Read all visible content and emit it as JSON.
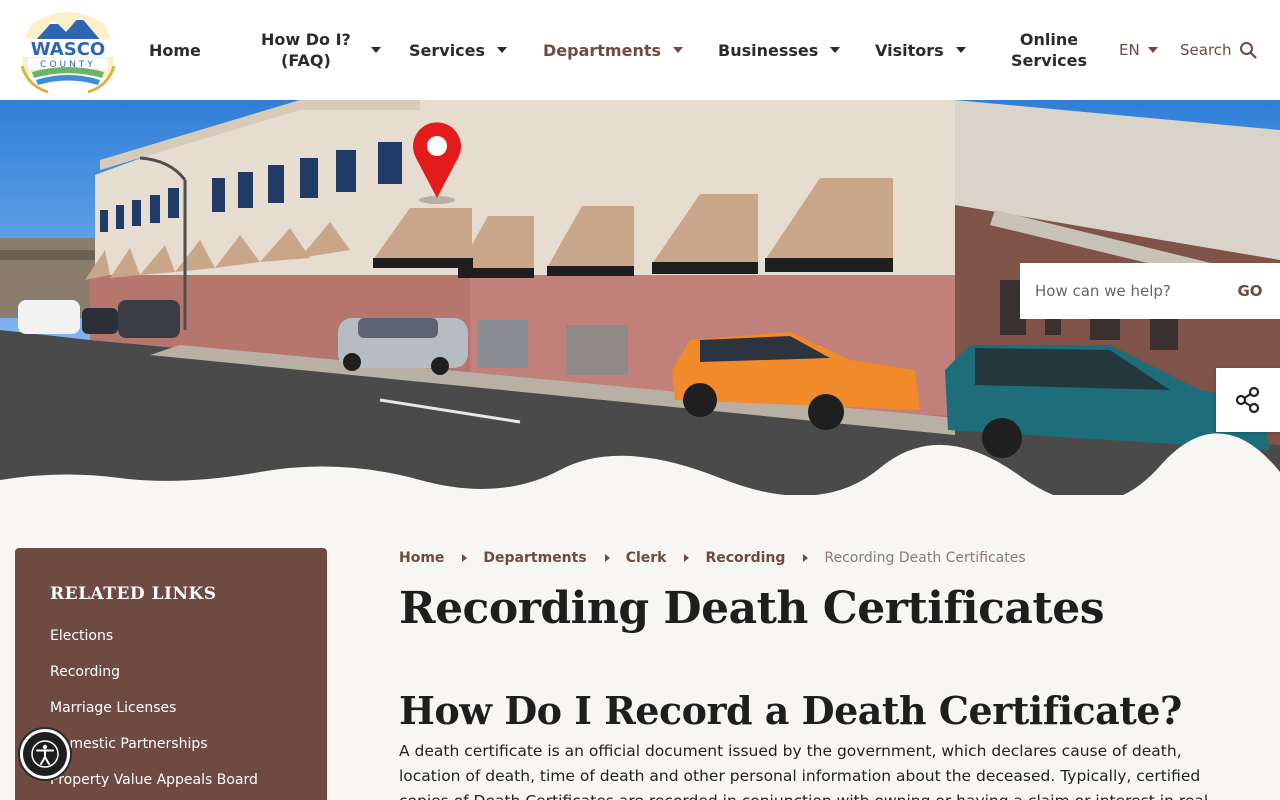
{
  "header": {
    "logo_text_top": "WASCO",
    "logo_text_bottom": "COUNTY",
    "nav": [
      {
        "label": "Home"
      },
      {
        "label_line1": "How Do I?",
        "label_line2": "(FAQ)"
      },
      {
        "label": "Services"
      },
      {
        "label": "Departments"
      },
      {
        "label": "Businesses"
      },
      {
        "label": "Visitors"
      },
      {
        "label_line1": "Online",
        "label_line2": "Services"
      }
    ],
    "language": "EN",
    "search_label": "Search"
  },
  "hero": {
    "help_placeholder": "How can we help?",
    "go_label": "GO"
  },
  "sidebar": {
    "title": "RELATED LINKS",
    "links": [
      "Elections",
      "Recording",
      "Marriage Licenses",
      "Domestic Partnerships",
      "Property Value Appeals Board"
    ]
  },
  "breadcrumb": {
    "items": [
      "Home",
      "Departments",
      "Clerk",
      "Recording"
    ],
    "current": "Recording Death Certificates"
  },
  "main": {
    "page_title": "Recording Death Certificates",
    "section_title": "How Do I Record a Death Certificate?",
    "body": "A death certificate is an official document issued by the government, which declares cause of death, location of death, time of death and other personal information about the deceased. Typically, certified copies of Death Certificates are recorded in conjunction with owning or having a claim or interest in real"
  },
  "colors": {
    "brand_brown": "#6e4a40",
    "header_bg": "#ffffff",
    "page_bg": "#f8f6f2"
  },
  "icons": {
    "search": "search-icon",
    "share": "share-icon",
    "accessibility": "accessibility-icon",
    "map_pin": "map-pin-icon"
  }
}
